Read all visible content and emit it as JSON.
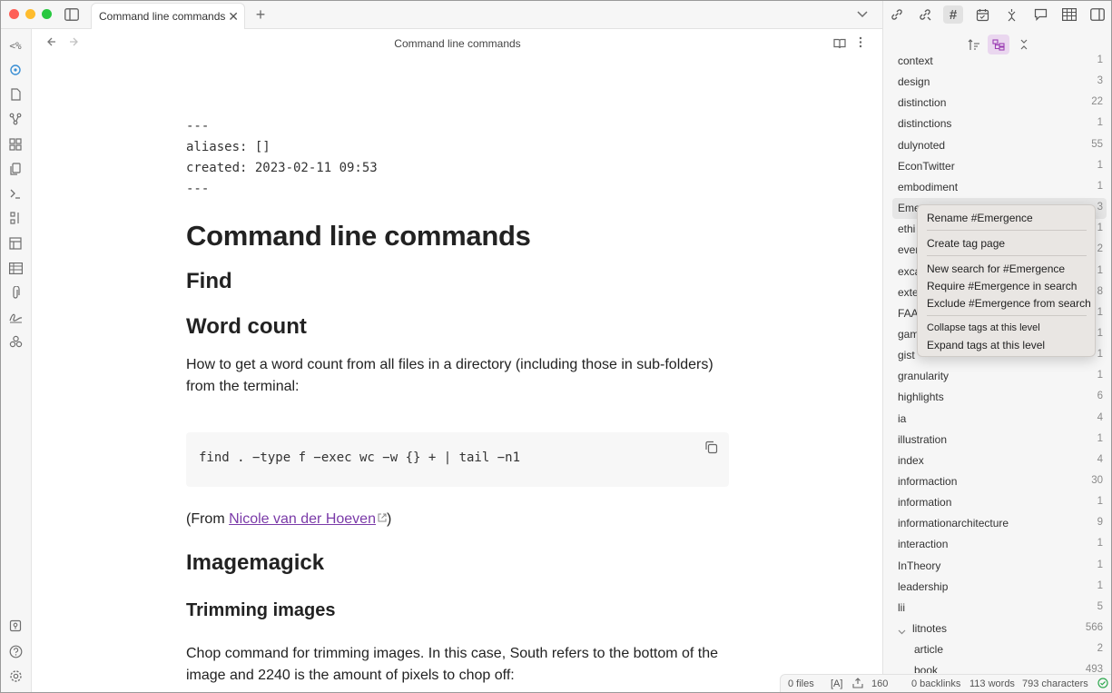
{
  "tab": {
    "title": "Command line commands",
    "close": "✕"
  },
  "editor": {
    "header_title": "Command line commands",
    "frontmatter": [
      "---",
      "aliases: []",
      "created: 2023-02-11 09:53",
      "---"
    ],
    "h1": "Command line commands",
    "h2_find": "Find",
    "h2_wordcount": "Word count",
    "p_wordcount": "How to get a word count from all files in a directory (including those in sub-folders) from the terminal:",
    "code": "find . −type f −exec wc −w {} + | tail −n1",
    "from_prefix": "(From ",
    "from_link": "Nicole van der Hoeven",
    "from_suffix": ")",
    "h2_imagemagick": "Imagemagick",
    "h3_trimming": "Trimming images",
    "p_trimming": "Chop command for trimming images. In this case, South refers to the bottom of the image and 2240 is the amount of pixels to chop off:"
  },
  "tags": [
    {
      "name": "context",
      "count": "1"
    },
    {
      "name": "design",
      "count": "3"
    },
    {
      "name": "distinction",
      "count": "22"
    },
    {
      "name": "distinctions",
      "count": "1"
    },
    {
      "name": "dulynoted",
      "count": "55"
    },
    {
      "name": "EconTwitter",
      "count": "1"
    },
    {
      "name": "embodiment",
      "count": "1"
    },
    {
      "name": "Eme",
      "count": "3"
    },
    {
      "name": "ethi",
      "count": "1"
    },
    {
      "name": "even",
      "count": "2"
    },
    {
      "name": "exca",
      "count": "1"
    },
    {
      "name": "exte",
      "count": "8"
    },
    {
      "name": "FAA",
      "count": "1"
    },
    {
      "name": "gam",
      "count": "1"
    },
    {
      "name": "gist",
      "count": "1"
    },
    {
      "name": "granularity",
      "count": "1"
    },
    {
      "name": "highlights",
      "count": "6"
    },
    {
      "name": "ia",
      "count": "4"
    },
    {
      "name": "illustration",
      "count": "1"
    },
    {
      "name": "index",
      "count": "4"
    },
    {
      "name": "informaction",
      "count": "30"
    },
    {
      "name": "information",
      "count": "1"
    },
    {
      "name": "informationarchitecture",
      "count": "9"
    },
    {
      "name": "interaction",
      "count": "1"
    },
    {
      "name": "InTheory",
      "count": "1"
    },
    {
      "name": "leadership",
      "count": "1"
    },
    {
      "name": "lii",
      "count": "5"
    },
    {
      "name": "litnotes",
      "count": "566"
    },
    {
      "name": "article",
      "count": "2"
    },
    {
      "name": "book",
      "count": "493"
    }
  ],
  "context_menu": {
    "rename": "Rename #Emergence",
    "create_page": "Create tag page",
    "new_search": "New search for #Emergence",
    "require": "Require #Emergence in search",
    "exclude": "Exclude #Emergence from search",
    "collapse": "Collapse tags at this level",
    "expand": "Expand tags at this level"
  },
  "status": {
    "files": "0 files",
    "a": "[A]",
    "count": "160",
    "backlinks": "0 backlinks",
    "words": "113 words",
    "characters": "793 characters"
  }
}
